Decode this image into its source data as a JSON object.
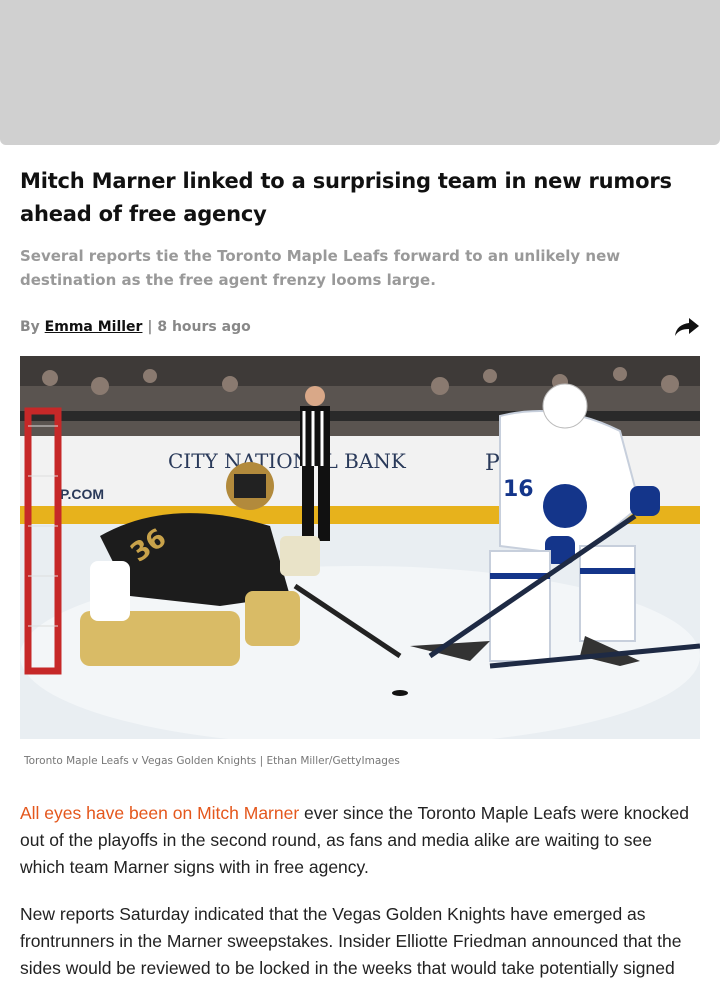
{
  "article": {
    "headline": "Mitch Marner linked to a surprising team in new rumors ahead of free agency",
    "subheadline": "Several reports tie the Toronto Maple Leafs forward to an unlikely new destination as the free agent frenzy looms large.",
    "byline": {
      "prefix": "By",
      "author": "Emma Miller",
      "separator": "|",
      "timestamp": "8 hours ago"
    },
    "share_icon": "share-arrow-icon",
    "hero_image": {
      "description_icon": "hockey-photo",
      "board_text": "CITY NATIONAL BANK",
      "board_text_right": "P",
      "board_text_left": "P.COM",
      "goalie_number": "36",
      "skater_number": "16",
      "caption": "Toronto Maple Leafs v Vegas Golden Knights | Ethan Miller/GettyImages"
    },
    "paragraphs": [
      {
        "link_text": "All eyes have been on Mitch Marner",
        "text": " ever since the Toronto Maple Leafs were knocked out of the playoffs in the second round, as fans and media alike are waiting to see which team Marner signs with in free agency."
      },
      {
        "text": "New reports Saturday indicated that the Vegas Golden Knights have emerged as frontrunners in the Marner sweepstakes. Insider Elliotte Friedman announced that the sides would be reviewed to be locked in the weeks that would take potentially signed"
      }
    ]
  },
  "colors": {
    "link": "#e4571c",
    "subhead": "#999999",
    "ad_placeholder": "#d0d0d0"
  }
}
